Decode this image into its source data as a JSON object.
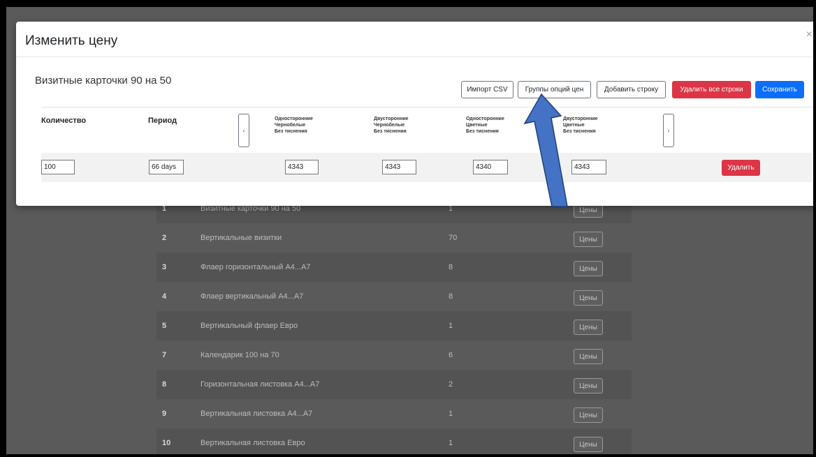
{
  "modal": {
    "title": "Изменить цену",
    "close": "×",
    "subtitle": "Визитные карточки 90 на 50",
    "buttons": {
      "import_csv": "Импорт CSV",
      "price_groups": "Группы опций цен",
      "add_row": "Добавить строку",
      "delete_all": "Удалить все строки",
      "save": "Сохранить"
    },
    "columns": {
      "quantity": "Количество",
      "period": "Период",
      "prev": "‹",
      "next": "›",
      "options": [
        [
          "Односторонние",
          "Черно­белые",
          "Без тиснения"
        ],
        [
          "Двусторонние",
          "Черно­белые",
          "Без тиснения"
        ],
        [
          "Односторонние",
          "Цветные",
          "Без тиснения"
        ],
        [
          "Двусторонние",
          "Цветные",
          "Без тиснения"
        ]
      ]
    },
    "row": {
      "quantity": "100",
      "period": "66 days",
      "prices": [
        "4343",
        "4343",
        "4340",
        "4343"
      ],
      "delete": "Удалить"
    }
  },
  "background_table": {
    "button_label": "Цены",
    "rows": [
      {
        "num": "1",
        "name": "Визитные карточки 90 на 50",
        "count": "1"
      },
      {
        "num": "2",
        "name": "Вертикальные визитки",
        "count": "70"
      },
      {
        "num": "3",
        "name": "Флаер горизонтальный А4...А7",
        "count": "8"
      },
      {
        "num": "4",
        "name": "Флаер вертикальный А4...А7",
        "count": "8"
      },
      {
        "num": "5",
        "name": "Вертикальный флаер Евро",
        "count": "1"
      },
      {
        "num": "7",
        "name": "Календарик 100 на 70",
        "count": "6"
      },
      {
        "num": "8",
        "name": "Горизонтальная листовка А4...А7",
        "count": "2"
      },
      {
        "num": "9",
        "name": "Вертикальная листовка А4...А7",
        "count": "1"
      },
      {
        "num": "10",
        "name": "Вертикальная листовка Евро",
        "count": "1"
      }
    ]
  },
  "colors": {
    "danger": "#dc3545",
    "primary": "#0d6efd",
    "arrow_fill": "#4472c4",
    "arrow_stroke": "#1f3f7a"
  }
}
